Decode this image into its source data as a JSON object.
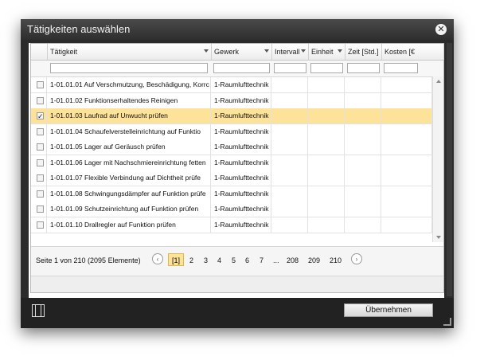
{
  "dialog": {
    "title": "Tätigkeiten auswählen",
    "close_glyph": "✕"
  },
  "grid": {
    "columns": [
      "Tätigkeit",
      "Gewerk",
      "Intervall",
      "Einheit",
      "Zeit [Std.]",
      "Kosten [€"
    ],
    "rows": [
      {
        "checked": false,
        "taetigkeit": "1-01.01.01 Auf Verschmutzung, Beschädigung, Korrc",
        "gewerk": "1-Raumlufttechnik"
      },
      {
        "checked": false,
        "taetigkeit": "1-01.01.02 Funktionserhaltendes Reinigen",
        "gewerk": "1-Raumlufttechnik"
      },
      {
        "checked": true,
        "taetigkeit": "1-01.01.03 Laufrad auf Unwucht prüfen",
        "gewerk": "1-Raumlufttechnik"
      },
      {
        "checked": false,
        "taetigkeit": "1-01.01.04 Schaufelverstelleinrichtung auf Funktio",
        "gewerk": "1-Raumlufttechnik"
      },
      {
        "checked": false,
        "taetigkeit": "1-01.01.05 Lager auf Geräusch prüfen",
        "gewerk": "1-Raumlufttechnik"
      },
      {
        "checked": false,
        "taetigkeit": "1-01.01.06 Lager mit Nachschmiereinrichtung fetten",
        "gewerk": "1-Raumlufttechnik"
      },
      {
        "checked": false,
        "taetigkeit": "1-01.01.07 Flexible Verbindung auf Dichtheit prüfe",
        "gewerk": "1-Raumlufttechnik"
      },
      {
        "checked": false,
        "taetigkeit": "1-01.01.08 Schwingungsdämpfer auf Funktion prüfe",
        "gewerk": "1-Raumlufttechnik"
      },
      {
        "checked": false,
        "taetigkeit": "1-01.01.09 Schutzeinrichtung auf Funktion prüfen",
        "gewerk": "1-Raumlufttechnik"
      },
      {
        "checked": false,
        "taetigkeit": "1-01.01.10 Drallregler auf Funktion prüfen",
        "gewerk": "1-Raumlufttechnik"
      }
    ],
    "selected_row_index": 2
  },
  "pager": {
    "info": "Seite 1 von 210 (2095 Elemente)",
    "prev_glyph": "‹",
    "next_glyph": "›",
    "current": "[1]",
    "pages": [
      "2",
      "3",
      "4",
      "5",
      "6",
      "7",
      "...",
      "208",
      "209",
      "210"
    ]
  },
  "footer": {
    "ok_label": "Übernehmen"
  },
  "colors": {
    "selected_row": "#fde39a",
    "dialog_frame": "#2b2b2b"
  }
}
